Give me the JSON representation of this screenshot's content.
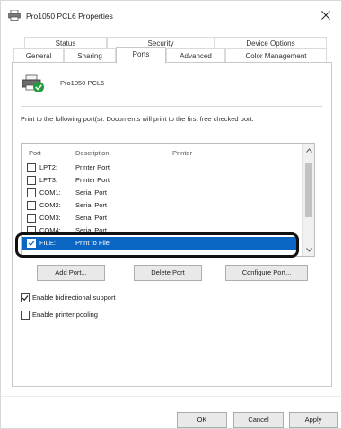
{
  "window": {
    "title": "Pro1050 PCL6 Properties"
  },
  "tabs_row1": [
    {
      "label": "Status"
    },
    {
      "label": "Security"
    },
    {
      "label": "Device Options"
    }
  ],
  "tabs_row2": [
    {
      "label": "General"
    },
    {
      "label": "Sharing"
    },
    {
      "label": "Ports",
      "active": true
    },
    {
      "label": "Advanced"
    },
    {
      "label": "Color Management"
    }
  ],
  "printer": {
    "name": "Pro1050 PCL6",
    "icon": "printer-check-icon"
  },
  "instruction": "Print to the following port(s). Documents will print to the first free checked port.",
  "port_list": {
    "columns": [
      "Port",
      "Description",
      "Printer"
    ],
    "rows": [
      {
        "port": "LPT2:",
        "description": "Printer Port",
        "checked": false
      },
      {
        "port": "LPT3:",
        "description": "Printer Port",
        "checked": false
      },
      {
        "port": "COM1:",
        "description": "Serial Port",
        "checked": false
      },
      {
        "port": "COM2:",
        "description": "Serial Port",
        "checked": false
      },
      {
        "port": "COM3:",
        "description": "Serial Port",
        "checked": false
      },
      {
        "port": "COM4:",
        "description": "Serial Port",
        "checked": false
      },
      {
        "port": "FILE:",
        "description": "Print to File",
        "checked": true,
        "selected": true
      }
    ]
  },
  "port_buttons": {
    "add": "Add Port...",
    "delete": "Delete Port",
    "configure": "Configure Port..."
  },
  "options": {
    "bidirectional": {
      "label": "Enable bidirectional support",
      "checked": true
    },
    "pooling": {
      "label": "Enable printer pooling",
      "checked": false
    }
  },
  "dialog_buttons": {
    "ok": "OK",
    "cancel": "Cancel",
    "apply": "Apply"
  },
  "colors": {
    "selection": "#0a66c2",
    "highlight_ring": "#111111"
  }
}
